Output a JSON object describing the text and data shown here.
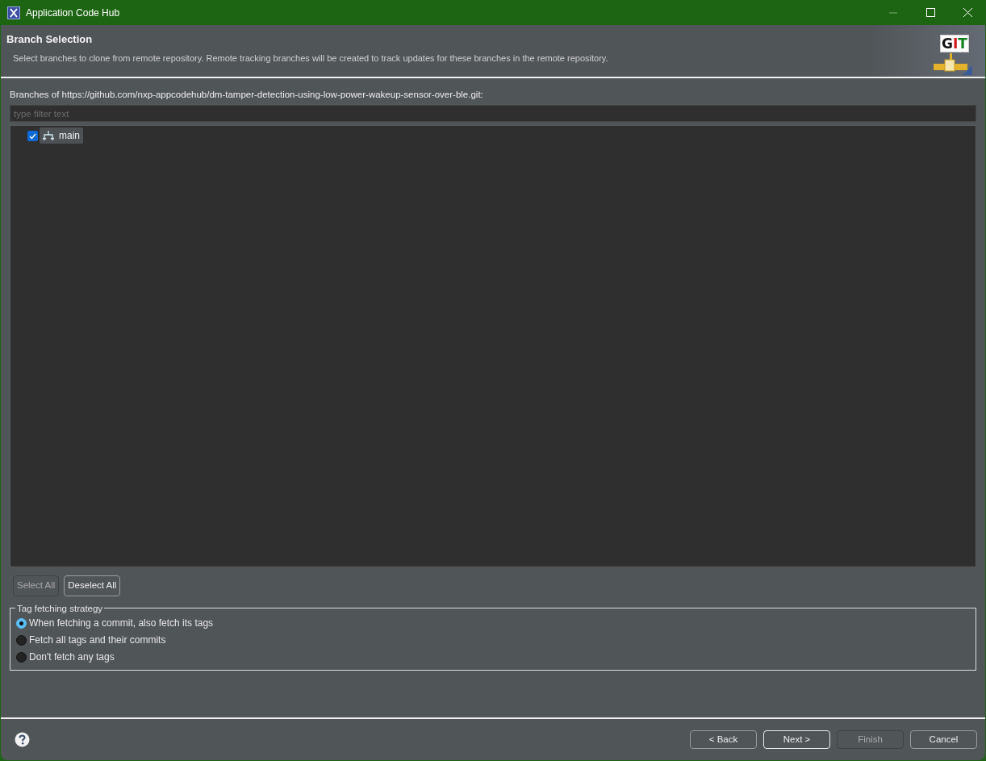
{
  "window": {
    "title": "Application Code Hub"
  },
  "header": {
    "title": "Branch Selection",
    "description": "Select branches to clone from remote repository. Remote tracking branches will be created to track updates for these branches in the remote repository.",
    "logo_text": "GIT"
  },
  "branches_label": "Branches of https://github.com/nxp-appcodehub/dm-tamper-detection-using-low-power-wakeup-sensor-over-ble.git:",
  "filter": {
    "placeholder": "type filter text"
  },
  "branches": [
    {
      "name": "main",
      "checked": true,
      "selected": true
    }
  ],
  "selection_buttons": [
    {
      "label": "Select All",
      "disabled": true
    },
    {
      "label": "Deselect All",
      "disabled": false
    }
  ],
  "tag_strategy": {
    "title": "Tag fetching strategy",
    "options": [
      {
        "label": "When fetching a commit, also fetch its tags",
        "selected": true
      },
      {
        "label": "Fetch all tags and their commits",
        "selected": false
      },
      {
        "label": "Don't fetch any tags",
        "selected": false
      }
    ]
  },
  "footer_buttons": [
    {
      "label": "< Back",
      "disabled": false,
      "default": false
    },
    {
      "label": "Next >",
      "disabled": false,
      "default": true
    },
    {
      "label": "Finish",
      "disabled": true,
      "default": false
    },
    {
      "label": "Cancel",
      "disabled": false,
      "default": false
    }
  ]
}
